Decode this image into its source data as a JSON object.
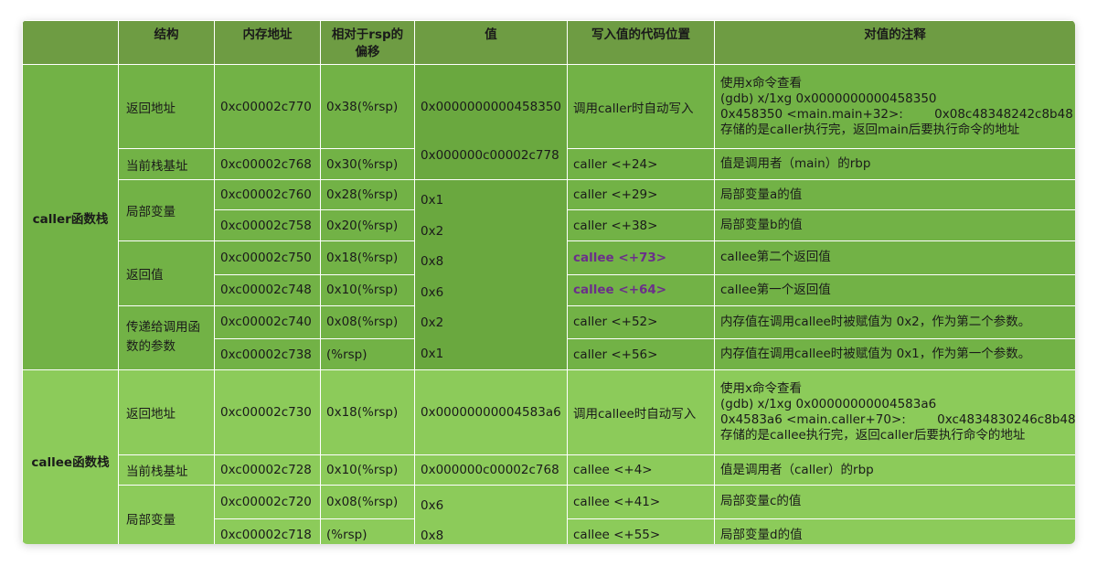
{
  "headers": [
    "",
    "结构",
    "内存地址",
    "相对于rsp的偏移",
    "值",
    "写入值的代码位置",
    "对值的注释"
  ],
  "caller_group": "caller函数栈",
  "callee_group": "callee函数栈",
  "caller": {
    "structs": [
      "返回地址",
      "当前栈基址",
      "局部变量",
      "返回值",
      "传递给调用函数的参数"
    ],
    "rows": [
      {
        "addr": "0xc00002c770",
        "off": "0x38(%rsp)",
        "val": "0x0000000000458350",
        "code": "调用caller时自动写入",
        "note": [
          "使用x命令查看",
          "(gdb) x/1xg 0x0000000000458350",
          "0x458350 <main.main+32>:        0x08c48348242c8b48",
          "存储的是caller执行完，返回main后要执行命令的地址"
        ]
      },
      {
        "addr": "0xc00002c768",
        "off": "0x30(%rsp)",
        "val": "0x000000c00002c778",
        "code": "caller <+24>",
        "note": [
          "值是调用者（main）的rbp"
        ]
      },
      {
        "addr": "0xc00002c760",
        "off": "0x28(%rsp)",
        "val": "0x1",
        "code": "caller <+29>",
        "note": [
          "局部变量a的值"
        ]
      },
      {
        "addr": "0xc00002c758",
        "off": "0x20(%rsp)",
        "val": "0x2",
        "code": "caller <+38>",
        "note": [
          "局部变量b的值"
        ]
      },
      {
        "addr": "0xc00002c750",
        "off": "0x18(%rsp)",
        "val": "0x8",
        "code": "callee <+73>",
        "note": [
          "callee第二个返回值"
        ]
      },
      {
        "addr": "0xc00002c748",
        "off": "0x10(%rsp)",
        "val": "0x6",
        "code": "callee <+64>",
        "note": [
          "callee第一个返回值"
        ]
      },
      {
        "addr": "0xc00002c740",
        "off": "0x08(%rsp)",
        "val": "0x2",
        "code": "caller <+52>",
        "note": [
          "内存值在调用callee时被赋值为 0x2，作为第二个参数。"
        ]
      },
      {
        "addr": "0xc00002c738",
        "off": "(%rsp)",
        "val": "0x1",
        "code": "caller <+56>",
        "note": [
          "内存值在调用callee时被赋值为 0x1，作为第一个参数。"
        ]
      }
    ]
  },
  "callee": {
    "structs": [
      "返回地址",
      "当前栈基址",
      "局部变量"
    ],
    "rows": [
      {
        "addr": "0xc00002c730",
        "off": "0x18(%rsp)",
        "val": "0x00000000004583a6",
        "code": "调用callee时自动写入",
        "note": [
          "使用x命令查看",
          "(gdb) x/1xg 0x00000000004583a6",
          "0x4583a6 <main.caller+70>:        0xc4834830246c8b48",
          "存储的是callee执行完，返回caller后要执行命令的地址"
        ]
      },
      {
        "addr": "0xc00002c728",
        "off": "0x10(%rsp)",
        "val": "0x000000c00002c768",
        "code": "callee <+4>",
        "note": [
          "值是调用者（caller）的rbp"
        ]
      },
      {
        "addr": "0xc00002c720",
        "off": "0x08(%rsp)",
        "val": "0x6",
        "code": "callee <+41>",
        "note": [
          "局部变量c的值"
        ]
      },
      {
        "addr": "0xc00002c718",
        "off": "(%rsp)",
        "val": "0x8",
        "code": "callee <+55>",
        "note": [
          "局部变量d的值"
        ]
      }
    ]
  },
  "colors": {
    "header": "#6e9c43",
    "caller": "#72b246",
    "callee": "#8ccb5a",
    "highlight": "#6b2f8a"
  }
}
